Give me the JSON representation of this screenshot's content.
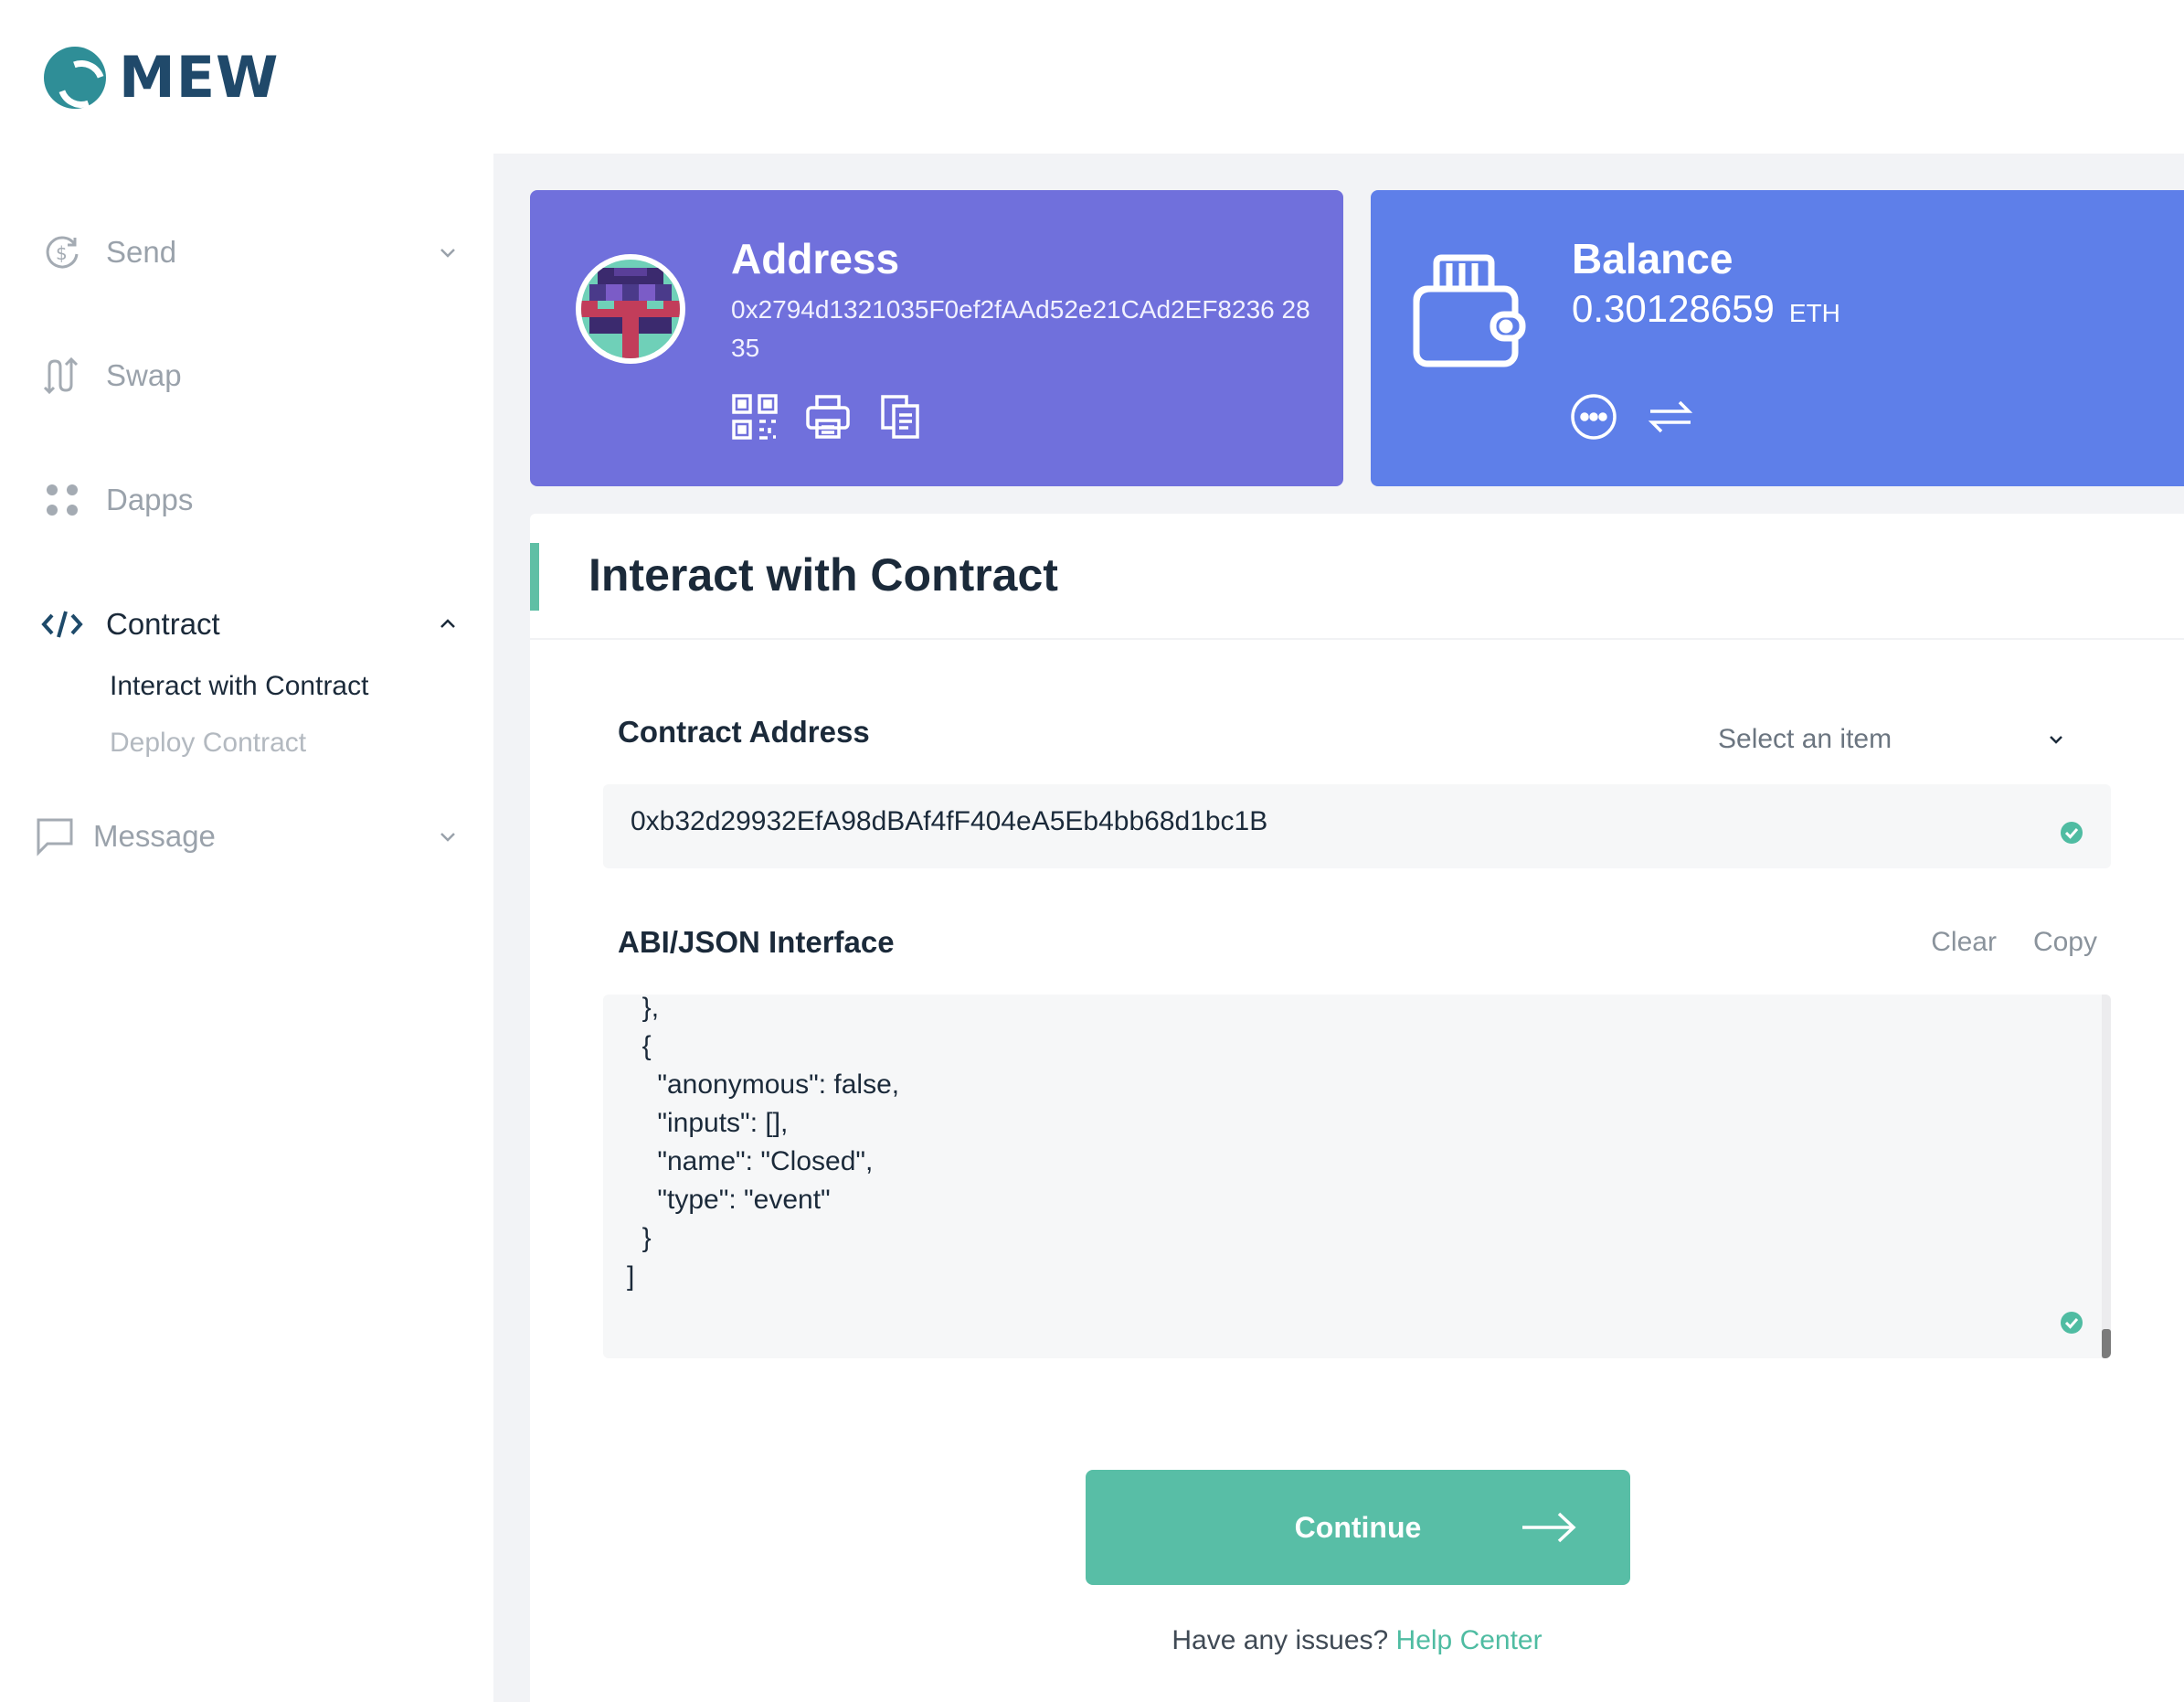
{
  "brand": {
    "name": "MEW"
  },
  "sidebar": {
    "items": [
      {
        "label": "Send",
        "icon": "send-icon"
      },
      {
        "label": "Swap",
        "icon": "swap-icon"
      },
      {
        "label": "Dapps",
        "icon": "dapps-icon"
      },
      {
        "label": "Contract",
        "icon": "contract-icon",
        "active": true,
        "children": [
          {
            "label": "Interact with Contract",
            "active": true
          },
          {
            "label": "Deploy Contract"
          }
        ]
      },
      {
        "label": "Message",
        "icon": "message-icon"
      }
    ]
  },
  "address_card": {
    "title": "Address",
    "address": "0x2794d1321035F0ef2fAAd52e21CAd2EF8236 2835",
    "icons": [
      "qr-code-icon",
      "print-icon",
      "copy-icon"
    ]
  },
  "balance_card": {
    "title": "Balance",
    "value": "0.30128659",
    "unit": "ETH",
    "icons": [
      "more-icon",
      "swap-arrows-icon"
    ]
  },
  "panel": {
    "title": "Interact with Contract",
    "contract_address": {
      "label": "Contract Address",
      "select_placeholder": "Select an item",
      "value": "0xb32d29932EfA98dBAf4fF404eA5Eb4bb68d1bc1B"
    },
    "abi": {
      "label": "ABI/JSON Interface",
      "clear_label": "Clear",
      "copy_label": "Copy",
      "content": "  },\n  {\n    \"anonymous\": false,\n    \"inputs\": [],\n    \"name\": \"Closed\",\n    \"type\": \"event\"\n  }\n]"
    },
    "continue_label": "Continue",
    "help_text": "Have any issues?",
    "help_link": "Help Center"
  },
  "colors": {
    "address_card": "#7070dc",
    "balance_card": "#5e7fe9",
    "accent": "#58bea6",
    "brand": "#20496a"
  }
}
